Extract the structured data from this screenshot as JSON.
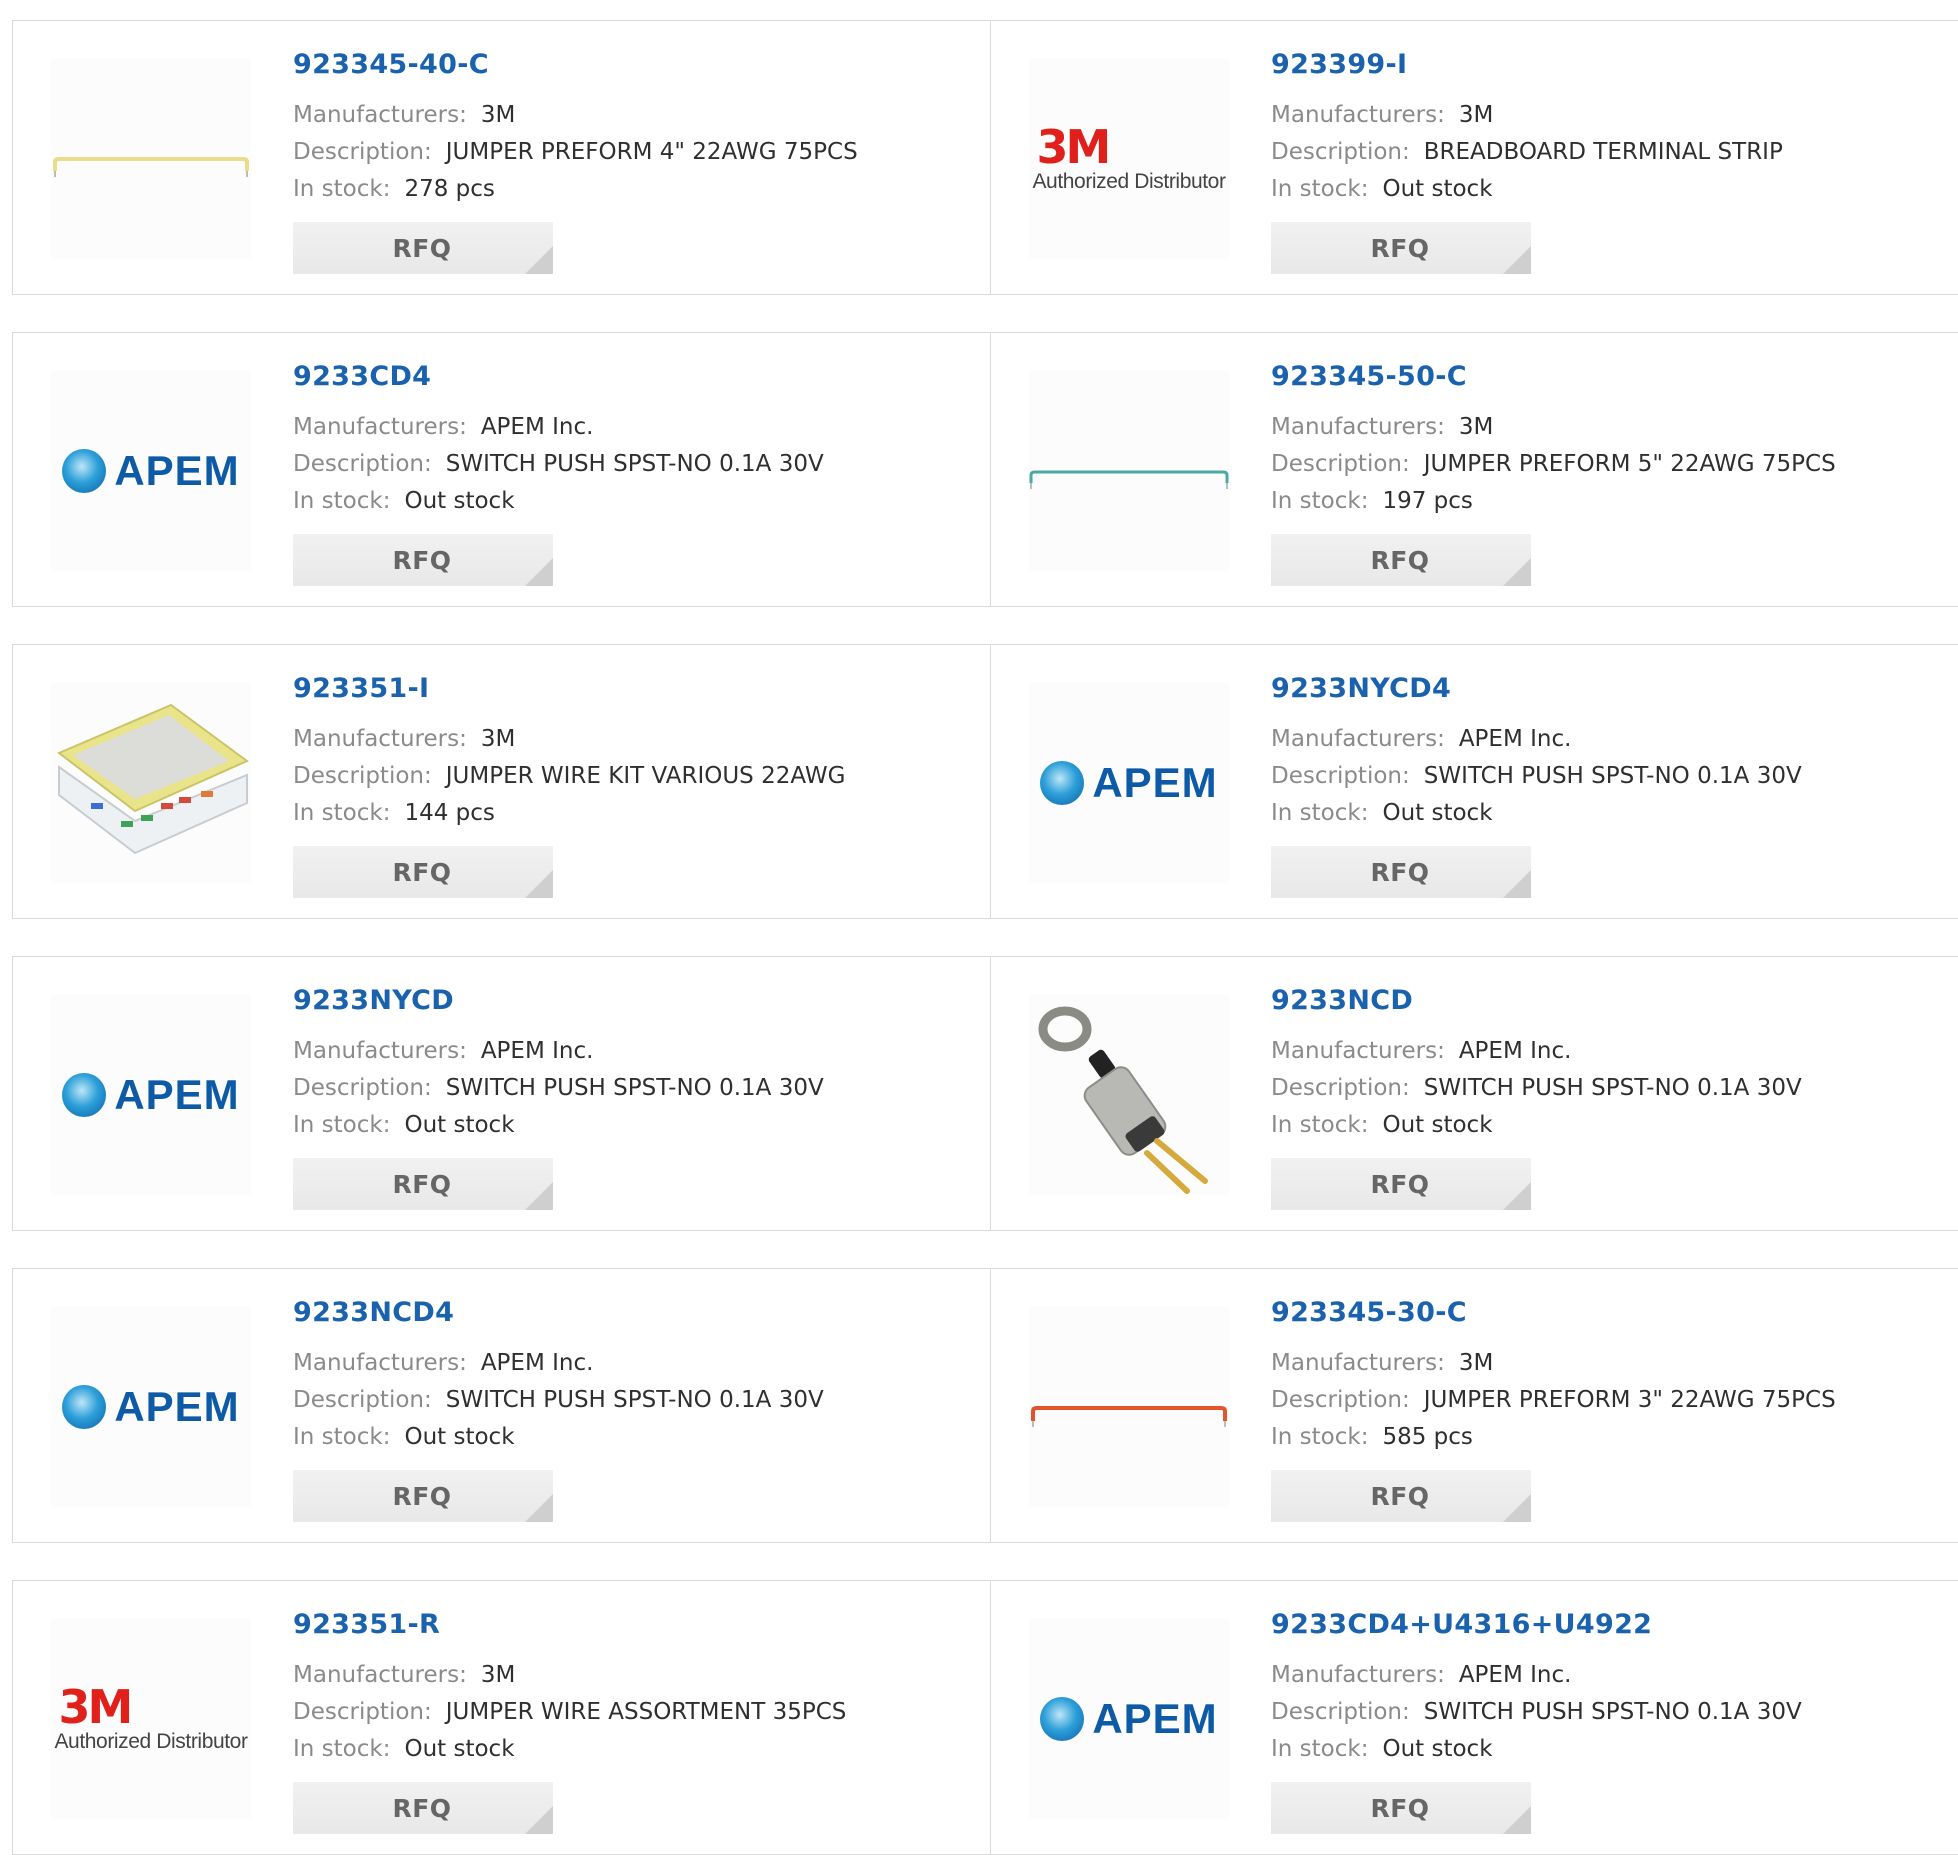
{
  "labels": {
    "manufacturers": "Manufacturers:",
    "description": "Description:",
    "stock": "In stock:",
    "rfq": "RFQ"
  },
  "logos": {
    "brand_3m": "3M",
    "brand_3m_sub": "Authorized Distributor",
    "brand_apem": "APEM"
  },
  "colors": {
    "part_link": "#1a62ae",
    "brand_3m_red": "#e0201b",
    "apem_blue": "#0d5aa7"
  },
  "products": [
    {
      "part": "923345-40-C",
      "manufacturer": "3M",
      "description": "JUMPER PREFORM 4\" 22AWG 75PCS",
      "stock": "278 pcs",
      "image": "jumper-wire-yellow"
    },
    {
      "part": "923399-I",
      "manufacturer": "3M",
      "description": "BREADBOARD TERMINAL STRIP",
      "stock": "Out stock",
      "image": "3m-logo"
    },
    {
      "part": "9233CD4",
      "manufacturer": "APEM Inc.",
      "description": "SWITCH PUSH SPST-NO 0.1A 30V",
      "stock": "Out stock",
      "image": "apem-logo"
    },
    {
      "part": "923345-50-C",
      "manufacturer": "3M",
      "description": "JUMPER PREFORM 5\" 22AWG 75PCS",
      "stock": "197 pcs",
      "image": "jumper-wire-teal"
    },
    {
      "part": "923351-I",
      "manufacturer": "3M",
      "description": "JUMPER WIRE KIT VARIOUS 22AWG",
      "stock": "144 pcs",
      "image": "jumper-kit-box"
    },
    {
      "part": "9233NYCD4",
      "manufacturer": "APEM Inc.",
      "description": "SWITCH PUSH SPST-NO 0.1A 30V",
      "stock": "Out stock",
      "image": "apem-logo"
    },
    {
      "part": "9233NYCD",
      "manufacturer": "APEM Inc.",
      "description": "SWITCH PUSH SPST-NO 0.1A 30V",
      "stock": "Out stock",
      "image": "apem-logo"
    },
    {
      "part": "9233NCD",
      "manufacturer": "APEM Inc.",
      "description": "SWITCH PUSH SPST-NO 0.1A 30V",
      "stock": "Out stock",
      "image": "push-switch-photo"
    },
    {
      "part": "9233NCD4",
      "manufacturer": "APEM Inc.",
      "description": "SWITCH PUSH SPST-NO 0.1A 30V",
      "stock": "Out stock",
      "image": "apem-logo"
    },
    {
      "part": "923345-30-C",
      "manufacturer": "3M",
      "description": "JUMPER PREFORM 3\" 22AWG 75PCS",
      "stock": "585 pcs",
      "image": "jumper-wire-red"
    },
    {
      "part": "923351-R",
      "manufacturer": "3M",
      "description": "JUMPER WIRE ASSORTMENT 35PCS",
      "stock": "Out stock",
      "image": "3m-logo"
    },
    {
      "part": "9233CD4+U4316+U4922",
      "manufacturer": "APEM Inc.",
      "description": "SWITCH PUSH SPST-NO 0.1A 30V",
      "stock": "Out stock",
      "image": "apem-logo"
    }
  ]
}
